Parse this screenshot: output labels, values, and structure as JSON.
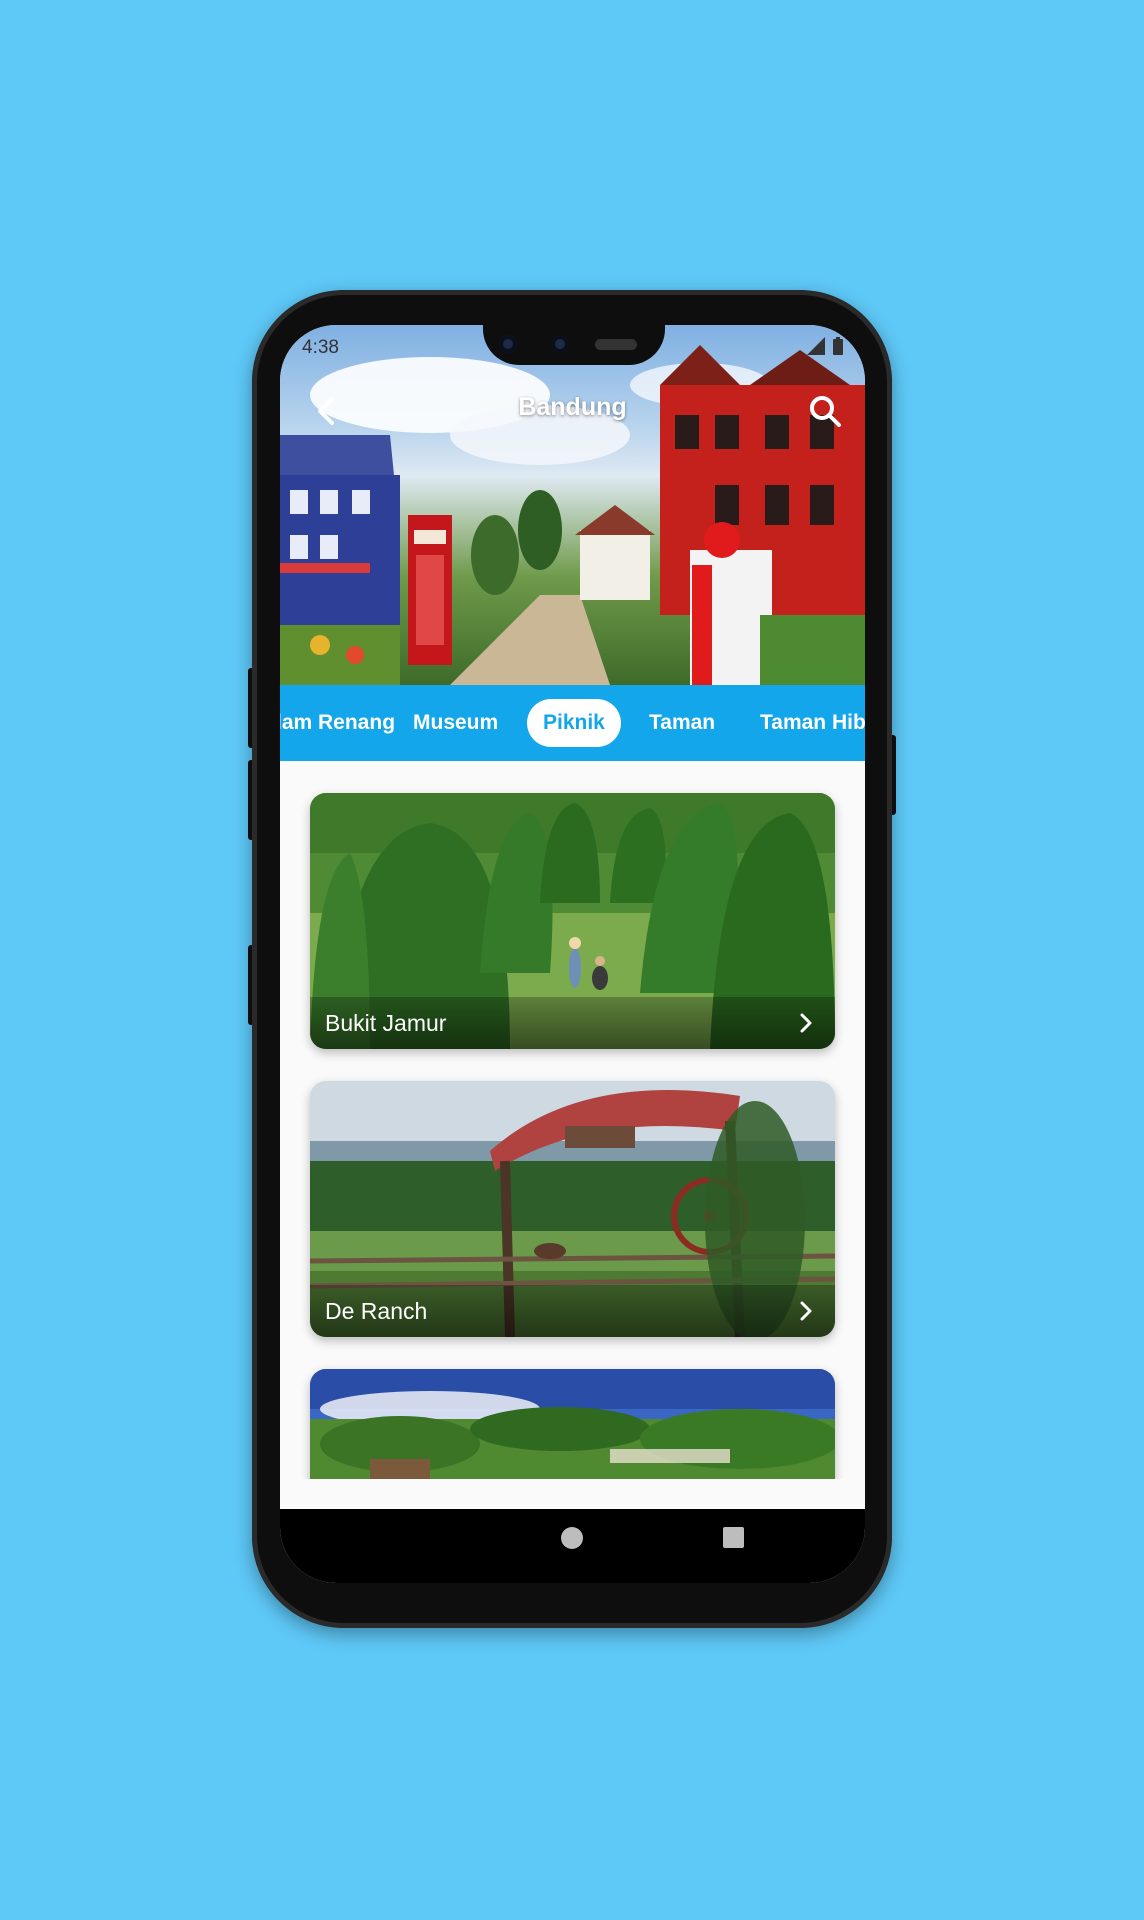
{
  "status_bar": {
    "time": "4:38"
  },
  "app_bar": {
    "title": "Bandung"
  },
  "tabs": [
    {
      "label": "Kolam Renang"
    },
    {
      "label": "Museum"
    },
    {
      "label": "Piknik"
    },
    {
      "label": "Taman"
    },
    {
      "label": "Taman Hiburan"
    }
  ],
  "selected_tab": "Piknik",
  "places": [
    {
      "name": "Bukit Jamur"
    },
    {
      "name": "De Ranch"
    },
    {
      "name": ""
    }
  ],
  "colors": {
    "background": "#5ec8f7",
    "tab_bar": "#14a6ea",
    "active_tab_text": "#14a6ea"
  },
  "icons": [
    "back-arrow-icon",
    "search-icon",
    "chevron-right-icon",
    "signal-icon",
    "battery-icon",
    "home-icon",
    "recents-icon"
  ]
}
